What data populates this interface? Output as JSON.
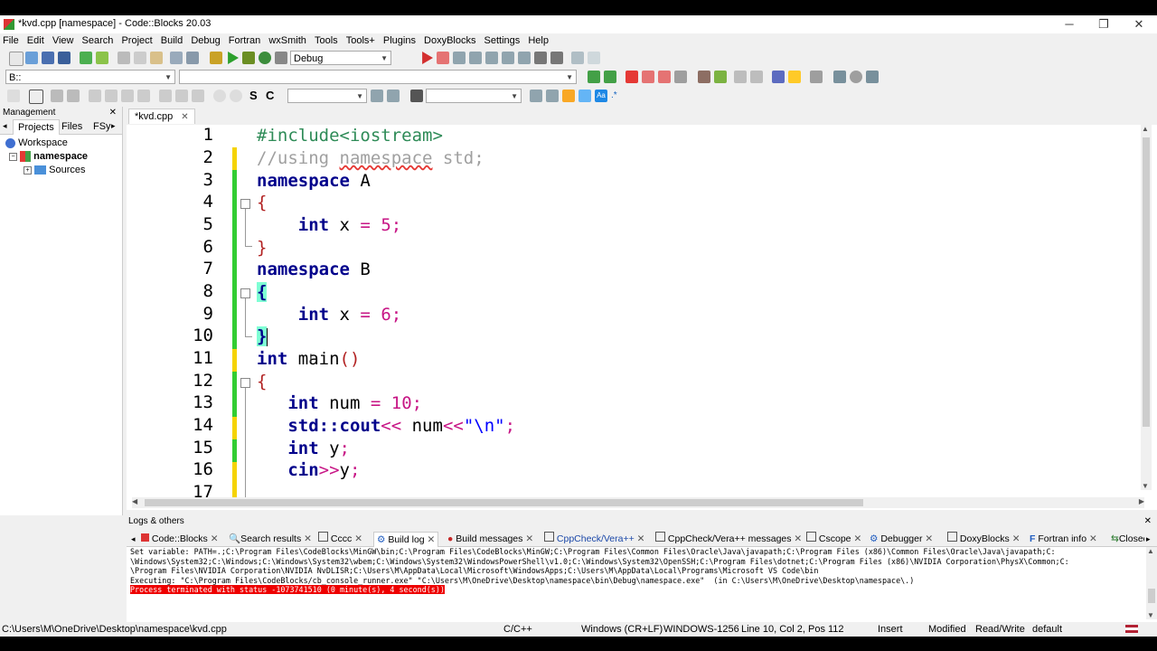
{
  "window": {
    "title": "*kvd.cpp [namespace] - Code::Blocks 20.03",
    "minimize_glyph": "─",
    "restore_glyph": "❐",
    "close_glyph": "✕"
  },
  "menu": [
    "File",
    "Edit",
    "View",
    "Search",
    "Project",
    "Build",
    "Debug",
    "Fortran",
    "wxSmith",
    "Tools",
    "Tools+",
    "Plugins",
    "DoxyBlocks",
    "Settings",
    "Help"
  ],
  "toolbar": {
    "build_target": "Debug",
    "scope_combo": "B::",
    "search_combo": "",
    "search_combo2": ""
  },
  "management": {
    "title": "Management",
    "tabs": [
      "Projects",
      "Files",
      "FSy"
    ],
    "tree": {
      "workspace": "Workspace",
      "project": "namespace",
      "folder": "Sources"
    }
  },
  "editor": {
    "tab_label": "*kvd.cpp",
    "line_numbers": [
      "1",
      "2",
      "3",
      "4",
      "5",
      "6",
      "7",
      "8",
      "9",
      "10",
      "11",
      "12",
      "13",
      "14",
      "15",
      "16",
      "17"
    ],
    "lines": {
      "l1": "#include<iostream>",
      "l2_a": "//using ",
      "l2_b": "namespace",
      "l2_c": " std;",
      "l3_kw": "namespace",
      "l3_id": " A",
      "l4": "{",
      "l5_kw": "int",
      "l5_a": " x ",
      "l5_op": "=",
      "l5_num": " 5",
      "l5_end": ";",
      "l6": "}",
      "l7_kw": "namespace",
      "l7_id": " B",
      "l8": "{",
      "l9_kw": "int",
      "l9_a": " x ",
      "l9_op": "=",
      "l9_num": " 6",
      "l9_end": ";",
      "l10": "}",
      "l11_kw": "int",
      "l11_a": " main",
      "l11_b": "()",
      "l12": "{",
      "l13_kw": "int",
      "l13_a": " num ",
      "l13_op": "=",
      "l13_num": " 10",
      "l13_end": ";",
      "l14_kw": "std::cout",
      "l14_op": "<<",
      "l14_a": " num",
      "l14_op2": "<<",
      "l14_str": "\"\\n\"",
      "l14_end": ";",
      "l15_kw": "int",
      "l15_a": " y",
      "l15_end": ";",
      "l16_kw": "cin",
      "l16_op": ">>",
      "l16_a": "y",
      "l16_end": ";"
    }
  },
  "logs": {
    "title": "Logs & others",
    "tabs": [
      "Code::Blocks",
      "Search results",
      "Cccc",
      "Build log",
      "Build messages",
      "CppCheck/Vera++",
      "CppCheck/Vera++ messages",
      "Cscope",
      "Debugger",
      "DoxyBlocks",
      "Fortran info",
      "Closed"
    ],
    "text_lines": [
      "Set variable: PATH=.;C:\\Program Files\\CodeBlocks\\MinGW\\bin;C:\\Program Files\\CodeBlocks\\MinGW;C:\\Program Files\\Common Files\\Oracle\\Java\\javapath;C:\\Program Files (x86)\\Common Files\\Oracle\\Java\\javapath;C:",
      "\\Windows\\System32;C:\\Windows;C:\\Windows\\System32\\wbem;C:\\Windows\\System32\\WindowsPowerShell\\v1.0;C:\\Windows\\System32\\OpenSSH;C:\\Program Files\\dotnet;C:\\Program Files (x86)\\NVIDIA Corporation\\PhysX\\Common;C:",
      "\\Program Files\\NVIDIA Corporation\\NVIDIA NvDLISR;C:\\Users\\M\\AppData\\Local\\Microsoft\\WindowsApps;C:\\Users\\M\\AppData\\Local\\Programs\\Microsoft VS Code\\bin",
      "Executing: \"C:\\Program Files\\CodeBlocks/cb_console_runner.exe\" \"C:\\Users\\M\\OneDrive\\Desktop\\namespace\\bin\\Debug\\namespace.exe\"  (in C:\\Users\\M\\OneDrive\\Desktop\\namespace\\.)"
    ],
    "error_line": "Process terminated with status -1073741510 (0 minute(s), 4 second(s))"
  },
  "status": {
    "path": "C:\\Users\\M\\OneDrive\\Desktop\\namespace\\kvd.cpp",
    "language": "C/C++",
    "eol": "Windows (CR+LF)",
    "encoding": "WINDOWS-1256",
    "position": "Line 10, Col 2, Pos 112",
    "insert": "Insert",
    "modified": "Modified",
    "rw": "Read/Write",
    "profile": "default"
  }
}
